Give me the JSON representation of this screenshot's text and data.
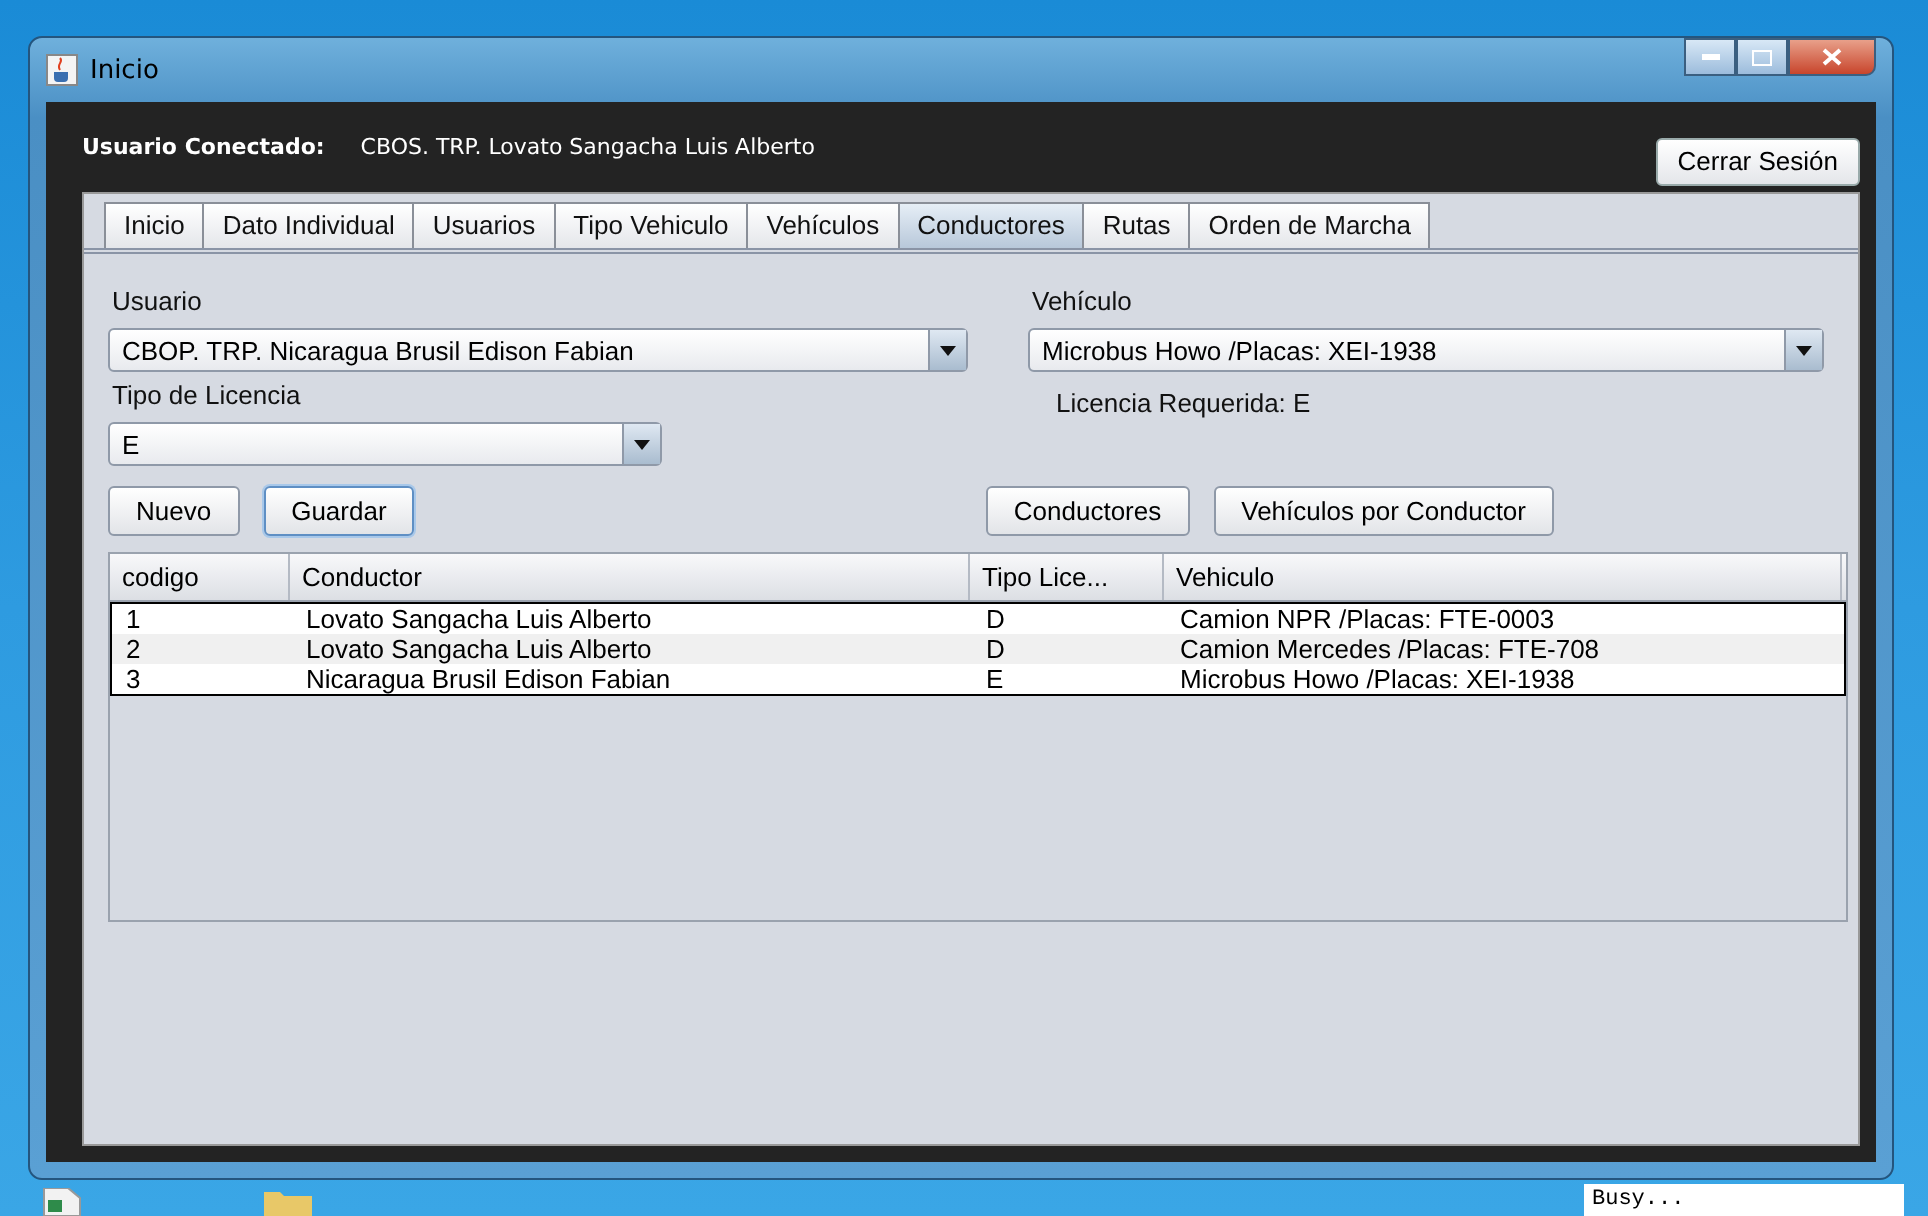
{
  "window": {
    "title": "Inicio"
  },
  "header": {
    "label": "Usuario Conectado:",
    "user": "CBOS. TRP. Lovato Sangacha Luis Alberto",
    "logout": "Cerrar Sesión"
  },
  "tabs": [
    {
      "label": "Inicio",
      "selected": false
    },
    {
      "label": "Dato Individual",
      "selected": false
    },
    {
      "label": "Usuarios",
      "selected": false
    },
    {
      "label": "Tipo Vehiculo",
      "selected": false
    },
    {
      "label": "Vehículos",
      "selected": false
    },
    {
      "label": "Conductores",
      "selected": true
    },
    {
      "label": "Rutas",
      "selected": false
    },
    {
      "label": "Orden de Marcha",
      "selected": false
    }
  ],
  "form": {
    "usuario": {
      "label": "Usuario",
      "value": "CBOP. TRP. Nicaragua Brusil Edison Fabian"
    },
    "vehiculo": {
      "label": "Vehículo",
      "value": "Microbus Howo /Placas: XEI-1938"
    },
    "licencia": {
      "label": "Tipo de Licencia",
      "value": "E"
    },
    "requerida": "Licencia Requerida: E"
  },
  "left_buttons": [
    {
      "label": "Nuevo",
      "focused": false
    },
    {
      "label": "Guardar",
      "focused": true
    }
  ],
  "right_buttons": [
    {
      "label": "Conductores",
      "focused": false
    },
    {
      "label": "Vehículos por Conductor",
      "focused": false
    }
  ],
  "table": {
    "columns": [
      "codigo",
      "Conductor",
      "Tipo Lice...",
      "Vehiculo"
    ],
    "rows": [
      [
        "1",
        "Lovato Sangacha Luis Alberto",
        "D",
        "Camion NPR /Placas: FTE-0003"
      ],
      [
        "2",
        "Lovato Sangacha Luis Alberto",
        "D",
        "Camion Mercedes /Placas: FTE-708"
      ],
      [
        "3",
        "Nicaragua Brusil Edison Fabian",
        "E",
        "Microbus Howo /Placas: XEI-1938"
      ]
    ]
  },
  "status_bar": {
    "text": "Busy..."
  }
}
